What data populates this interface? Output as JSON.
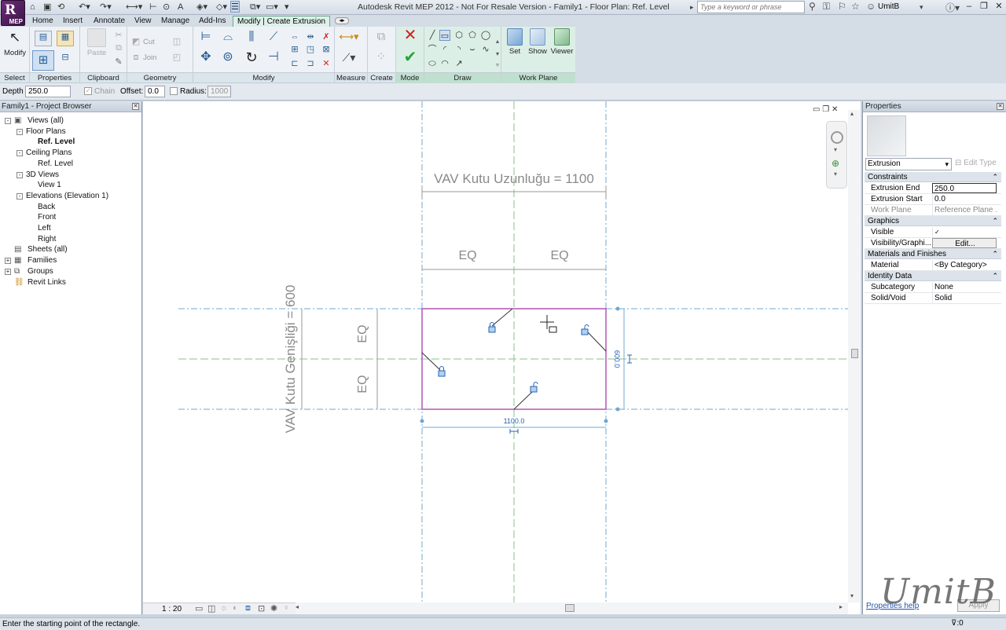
{
  "app": {
    "badge": "MEP",
    "title": "Autodesk Revit MEP 2012 -  Not For Resale Version -    Family1 - Floor Plan: Ref. Level",
    "search_placeholder": "Type a keyword or phrase",
    "user": "UmitB"
  },
  "tabs": [
    "Home",
    "Insert",
    "Annotate",
    "View",
    "Manage",
    "Add-Ins",
    "Modify | Create Extrusion"
  ],
  "ribbon": {
    "panels": {
      "select": "Select",
      "properties": "Properties",
      "clipboard": "Clipboard",
      "geometry": "Geometry",
      "modify": "Modify",
      "measure": "Measure",
      "create": "Create",
      "mode": "Mode",
      "draw": "Draw",
      "workplane": "Work Plane"
    },
    "buttons": {
      "modify": "Modify",
      "paste": "Paste",
      "cut": "Cut",
      "join": "Join",
      "set": "Set",
      "show": "Show",
      "viewer": "Viewer"
    }
  },
  "options_bar": {
    "depth_label": "Depth",
    "depth_value": "250.0",
    "chain_label": "Chain",
    "offset_label": "Offset:",
    "offset_value": "0.0",
    "radius_label": "Radius:",
    "radius_value": "1000"
  },
  "project_browser": {
    "title": "Family1 - Project Browser",
    "items": [
      {
        "label": "Views (all)",
        "level": 0,
        "toggle": "-",
        "icon": "views"
      },
      {
        "label": "Floor Plans",
        "level": 1,
        "toggle": "-"
      },
      {
        "label": "Ref. Level",
        "level": 2,
        "bold": true
      },
      {
        "label": "Ceiling Plans",
        "level": 1,
        "toggle": "-"
      },
      {
        "label": "Ref. Level",
        "level": 2
      },
      {
        "label": "3D Views",
        "level": 1,
        "toggle": "-"
      },
      {
        "label": "View 1",
        "level": 2
      },
      {
        "label": "Elevations (Elevation 1)",
        "level": 1,
        "toggle": "-"
      },
      {
        "label": "Back",
        "level": 2
      },
      {
        "label": "Front",
        "level": 2
      },
      {
        "label": "Left",
        "level": 2
      },
      {
        "label": "Right",
        "level": 2
      },
      {
        "label": "Sheets (all)",
        "level": 0,
        "icon": "sheets"
      },
      {
        "label": "Families",
        "level": 0,
        "toggle": "+",
        "icon": "families"
      },
      {
        "label": "Groups",
        "level": 0,
        "toggle": "+",
        "icon": "groups"
      },
      {
        "label": "Revit Links",
        "level": 0,
        "icon": "links"
      }
    ]
  },
  "drawing": {
    "dim_length": "VAV Kutu Uzunluğu = 1100",
    "dim_width": "VAV Kutu Genişliği = 600",
    "eq": "EQ",
    "temp_dim_length": "1100.0",
    "temp_dim_width": "600.0",
    "scale": "1 : 20"
  },
  "properties": {
    "title": "Properties",
    "type": "Extrusion",
    "edit_type": "Edit Type",
    "categories": [
      {
        "name": "Constraints",
        "rows": [
          {
            "key": "Extrusion End",
            "value": "250.0"
          },
          {
            "key": "Extrusion Start",
            "value": "0.0"
          },
          {
            "key": "Work Plane",
            "value": "Reference Plane ...",
            "disabled": true
          }
        ]
      },
      {
        "name": "Graphics",
        "rows": [
          {
            "key": "Visible",
            "value": "✓"
          },
          {
            "key": "Visibility/Graphi...",
            "value": "Edit..."
          }
        ]
      },
      {
        "name": "Materials and Finishes",
        "rows": [
          {
            "key": "Material",
            "value": "<By Category>"
          }
        ]
      },
      {
        "name": "Identity Data",
        "rows": [
          {
            "key": "Subcategory",
            "value": "None"
          },
          {
            "key": "Solid/Void",
            "value": "Solid"
          }
        ]
      }
    ],
    "help": "Properties help",
    "apply": "Apply"
  },
  "watermark": "UmitB",
  "status": {
    "text": "Enter the starting point of the rectangle.",
    "filter": ":0"
  },
  "colors": {
    "sketch": "#b455b4",
    "dim": "#2a63b0",
    "refplane": "#6fa8d0",
    "refplane_green": "#88c088",
    "context_tab": "#6aa88d"
  }
}
